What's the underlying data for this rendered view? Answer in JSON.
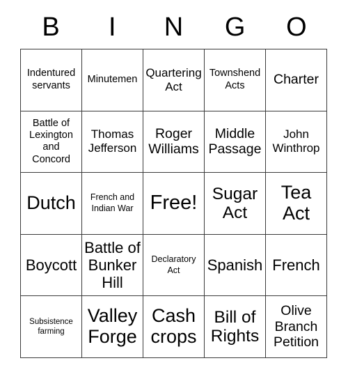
{
  "card": {
    "title": "BINGO",
    "header_letters": [
      "B",
      "I",
      "N",
      "G",
      "O"
    ],
    "grid_size": 5,
    "free_space": {
      "row": 3,
      "column": 3,
      "label": "Free!"
    },
    "border_color": "#3a3a3a",
    "text_color": "#000000",
    "background_color": "#ffffff",
    "rows": [
      [
        {
          "label": "Indentured servants",
          "size": "fs-m"
        },
        {
          "label": "Minutemen",
          "size": "fs-m"
        },
        {
          "label": "Quartering Act",
          "size": "fs-ml"
        },
        {
          "label": "Townshend Acts",
          "size": "fs-m"
        },
        {
          "label": "Charter",
          "size": "fs-l"
        }
      ],
      [
        {
          "label": "Battle of Lexington and Concord",
          "size": "fs-m"
        },
        {
          "label": "Thomas Jefferson",
          "size": "fs-ml"
        },
        {
          "label": "Roger Williams",
          "size": "fs-l"
        },
        {
          "label": "Middle Passage",
          "size": "fs-l"
        },
        {
          "label": "John Winthrop",
          "size": "fs-ml"
        }
      ],
      [
        {
          "label": "Dutch",
          "size": "fs-3xl"
        },
        {
          "label": "French and Indian War",
          "size": "fs-s"
        },
        {
          "label": "Free!",
          "size": "fs-4xl"
        },
        {
          "label": "Sugar Act",
          "size": "fs-2xl"
        },
        {
          "label": "Tea Act",
          "size": "fs-3xl"
        }
      ],
      [
        {
          "label": "Boycott",
          "size": "fs-xl"
        },
        {
          "label": "Battle of Bunker Hill",
          "size": "fs-xl"
        },
        {
          "label": "Declaratory Act",
          "size": "fs-s"
        },
        {
          "label": "Spanish",
          "size": "fs-xl"
        },
        {
          "label": "French",
          "size": "fs-xl"
        }
      ],
      [
        {
          "label": "Subsistence farming",
          "size": "fs-xs"
        },
        {
          "label": "Valley Forge",
          "size": "fs-3xl"
        },
        {
          "label": "Cash crops",
          "size": "fs-3xl"
        },
        {
          "label": "Bill of Rights",
          "size": "fs-2xl"
        },
        {
          "label": "Olive Branch Petition",
          "size": "fs-l"
        }
      ]
    ]
  }
}
